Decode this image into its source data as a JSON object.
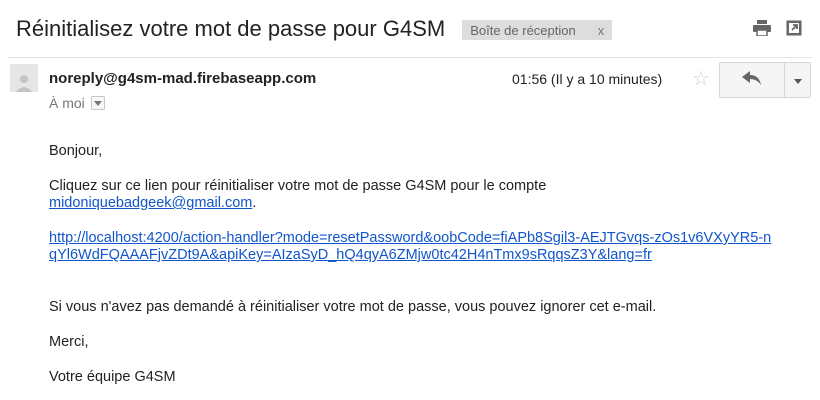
{
  "header": {
    "subject": "Réinitialisez votre mot de passe pour G4SM",
    "label": "Boîte de réception",
    "label_close": "x"
  },
  "message": {
    "sender": "noreply@g4sm-mad.firebaseapp.com",
    "recipient": "À moi",
    "timestamp": "01:56 (Il y a 10 minutes)"
  },
  "body": {
    "greeting": "Bonjour,",
    "instruction": "Cliquez sur ce lien pour réinitialiser votre mot de passe G4SM pour le compte",
    "account_email": "midoniquebadgeek@gmail.com",
    "account_suffix": ".",
    "reset_link": "http://localhost:4200/action-handler?mode=resetPassword&oobCode=fiAPb8Sgil3-AEJTGvqs-zOs1v6VXyYR5-nqYl6WdFQAAAFjvZDt9A&apiKey=AIzaSyD_hQ4qyA6ZMjw0tc42H4nTmx9sRqqsZ3Y&lang=fr",
    "ignore_note": "Si vous n'avez pas demandé à réinitialiser votre mot de passe, vous pouvez ignorer cet e-mail.",
    "thanks": "Merci,",
    "signature": "Votre équipe G4SM"
  },
  "icons": {
    "print": "print-icon",
    "new_window": "new-window-icon",
    "star": "star-icon",
    "reply": "reply-icon",
    "more": "chevron-down-icon",
    "avatar": "person-icon"
  },
  "colors": {
    "link": "#1155cc",
    "label_bg": "#dddddd",
    "muted": "#777777"
  }
}
